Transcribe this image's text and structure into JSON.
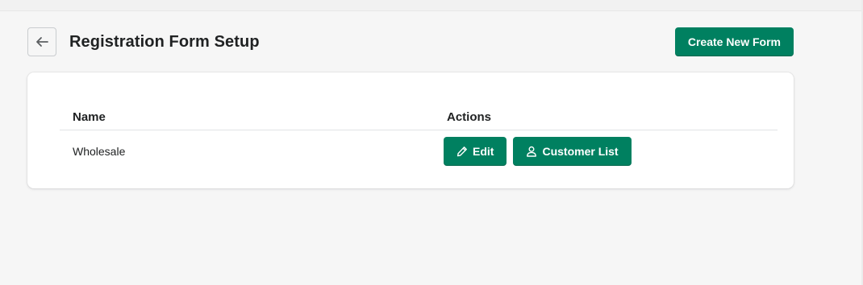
{
  "header": {
    "back_icon": "arrow-left-icon",
    "title": "Registration Form Setup",
    "create_button_label": "Create New Form"
  },
  "table": {
    "columns": [
      "Name",
      "Actions"
    ],
    "rows": [
      {
        "name": "Wholesale",
        "actions": {
          "edit_label": "Edit",
          "edit_icon": "pencil-icon",
          "customers_label": "Customer List",
          "customers_icon": "user-icon"
        }
      }
    ]
  },
  "colors": {
    "primary": "#008060",
    "background": "#f6f6f6",
    "card": "#ffffff",
    "text": "#202223"
  }
}
